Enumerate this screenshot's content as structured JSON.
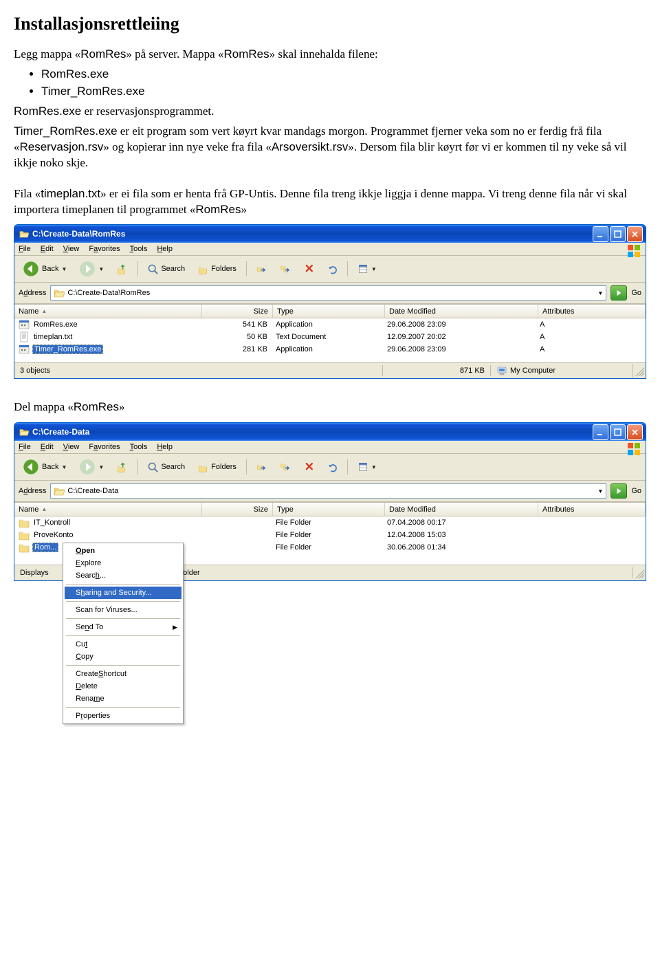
{
  "doc": {
    "title": "Installasjonsrettleiing",
    "intro_line1": "Legg mappa «",
    "romres1": "RomRes",
    "intro_line1b": "» på server. Mappa «",
    "romres2": "RomRes",
    "intro_line1c": "» skal innehalda filene:",
    "bullets": [
      "RomRes.exe",
      "Timer_RomRes.exe"
    ],
    "p2_a": "RomRes.exe",
    "p2_b": " er reservasjonsprogrammet.",
    "p3_a": "Timer_RomRes.exe",
    "p3_b": " er eit program som vert køyrt kvar mandags morgon. Programmet fjerner veka som no er ferdig frå fila «",
    "p3_c": "Reservasjon.rsv",
    "p3_d": "» og kopierar inn nye veke fra fila «",
    "p3_e": "Arsoversikt.rsv",
    "p3_f": "». Dersom fila blir køyrt før vi er kommen til ny veke så vil ikkje noko skje.",
    "p4_a": "Fila «",
    "p4_b": "timeplan.txt",
    "p4_c": "» er ei fila som er henta frå GP-Untis. Denne fila treng ikkje liggja i denne mappa. Vi treng denne fila når vi skal importera timeplanen til programmet «",
    "p4_d": "RomRes",
    "p4_e": "»",
    "del_mappa_a": "Del mappa «",
    "del_mappa_b": "RomRes",
    "del_mappa_c": "»"
  },
  "win1": {
    "title": "C:\\Create-Data\\RomRes",
    "menus": [
      "File",
      "Edit",
      "View",
      "Favorites",
      "Tools",
      "Help"
    ],
    "toolbar": {
      "back": "Back",
      "search": "Search",
      "folders": "Folders"
    },
    "address_label": "Address",
    "address_value": "C:\\Create-Data\\RomRes",
    "go": "Go",
    "columns": [
      "Name",
      "Size",
      "Type",
      "Date Modified",
      "Attributes"
    ],
    "rows": [
      {
        "icon": "exe",
        "name": "RomRes.exe",
        "size": "541 KB",
        "type": "Application",
        "date": "29.06.2008 23:09",
        "attr": "A"
      },
      {
        "icon": "txt",
        "name": "timeplan.txt",
        "size": "50 KB",
        "type": "Text Document",
        "date": "12.09.2007 20:02",
        "attr": "A"
      },
      {
        "icon": "exe",
        "name": "Timer_RomRes.exe",
        "size": "281 KB",
        "type": "Application",
        "date": "29.06.2008 23:09",
        "attr": "A",
        "selected": true
      }
    ],
    "status": {
      "left": "3 objects",
      "mid": "871 KB",
      "right": "My Computer"
    }
  },
  "win2": {
    "title": "C:\\Create-Data",
    "menus": [
      "File",
      "Edit",
      "View",
      "Favorites",
      "Tools",
      "Help"
    ],
    "toolbar": {
      "back": "Back",
      "search": "Search",
      "folders": "Folders"
    },
    "address_label": "Address",
    "address_value": "C:\\Create-Data",
    "go": "Go",
    "columns": [
      "Name",
      "Size",
      "Type",
      "Date Modified",
      "Attributes"
    ],
    "rows": [
      {
        "icon": "folder",
        "name": "IT_Kontroll",
        "size": "",
        "type": "File Folder",
        "date": "07.04.2008 00:17",
        "attr": ""
      },
      {
        "icon": "folder",
        "name": "ProveKonto",
        "size": "",
        "type": "File Folder",
        "date": "12.04.2008 15:03",
        "attr": ""
      },
      {
        "icon": "folder",
        "name": "RomRes",
        "size": "",
        "type": "File Folder",
        "date": "30.06.2008 01:34",
        "attr": "",
        "selected": true,
        "truncated": true
      }
    ],
    "status": {
      "left": "Displays",
      "left_suffix": "elected folder",
      "mid": "",
      "right": ""
    }
  },
  "ctx": {
    "items": [
      {
        "label": "Open",
        "bold": true
      },
      {
        "label": "Explore"
      },
      {
        "label": "Search..."
      },
      {
        "sep": true
      },
      {
        "label": "Sharing and Security...",
        "hl": true
      },
      {
        "sep": true
      },
      {
        "label": "Scan for Viruses..."
      },
      {
        "sep": true
      },
      {
        "label": "Send To",
        "arrow": true
      },
      {
        "sep": true
      },
      {
        "label": "Cut"
      },
      {
        "label": "Copy"
      },
      {
        "sep": true
      },
      {
        "label": "Create Shortcut"
      },
      {
        "label": "Delete"
      },
      {
        "label": "Rename"
      },
      {
        "sep": true
      },
      {
        "label": "Properties"
      }
    ]
  }
}
